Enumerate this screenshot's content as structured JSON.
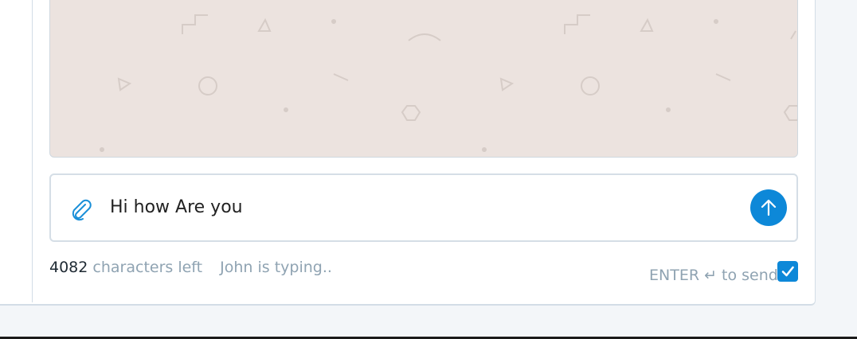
{
  "composer": {
    "message_value": "Hi how Are you",
    "attach_icon": "paperclip-icon",
    "send_icon": "arrow-up-icon"
  },
  "footer": {
    "char_count": "4082",
    "char_label": "characters left",
    "typing_status": "John is typing..",
    "enter_label": "ENTER ↵ to send",
    "enter_to_send_checked": true
  },
  "colors": {
    "accent": "#0d88d8",
    "chat_bg": "#ece3df",
    "muted_text": "#8fa3b2"
  }
}
